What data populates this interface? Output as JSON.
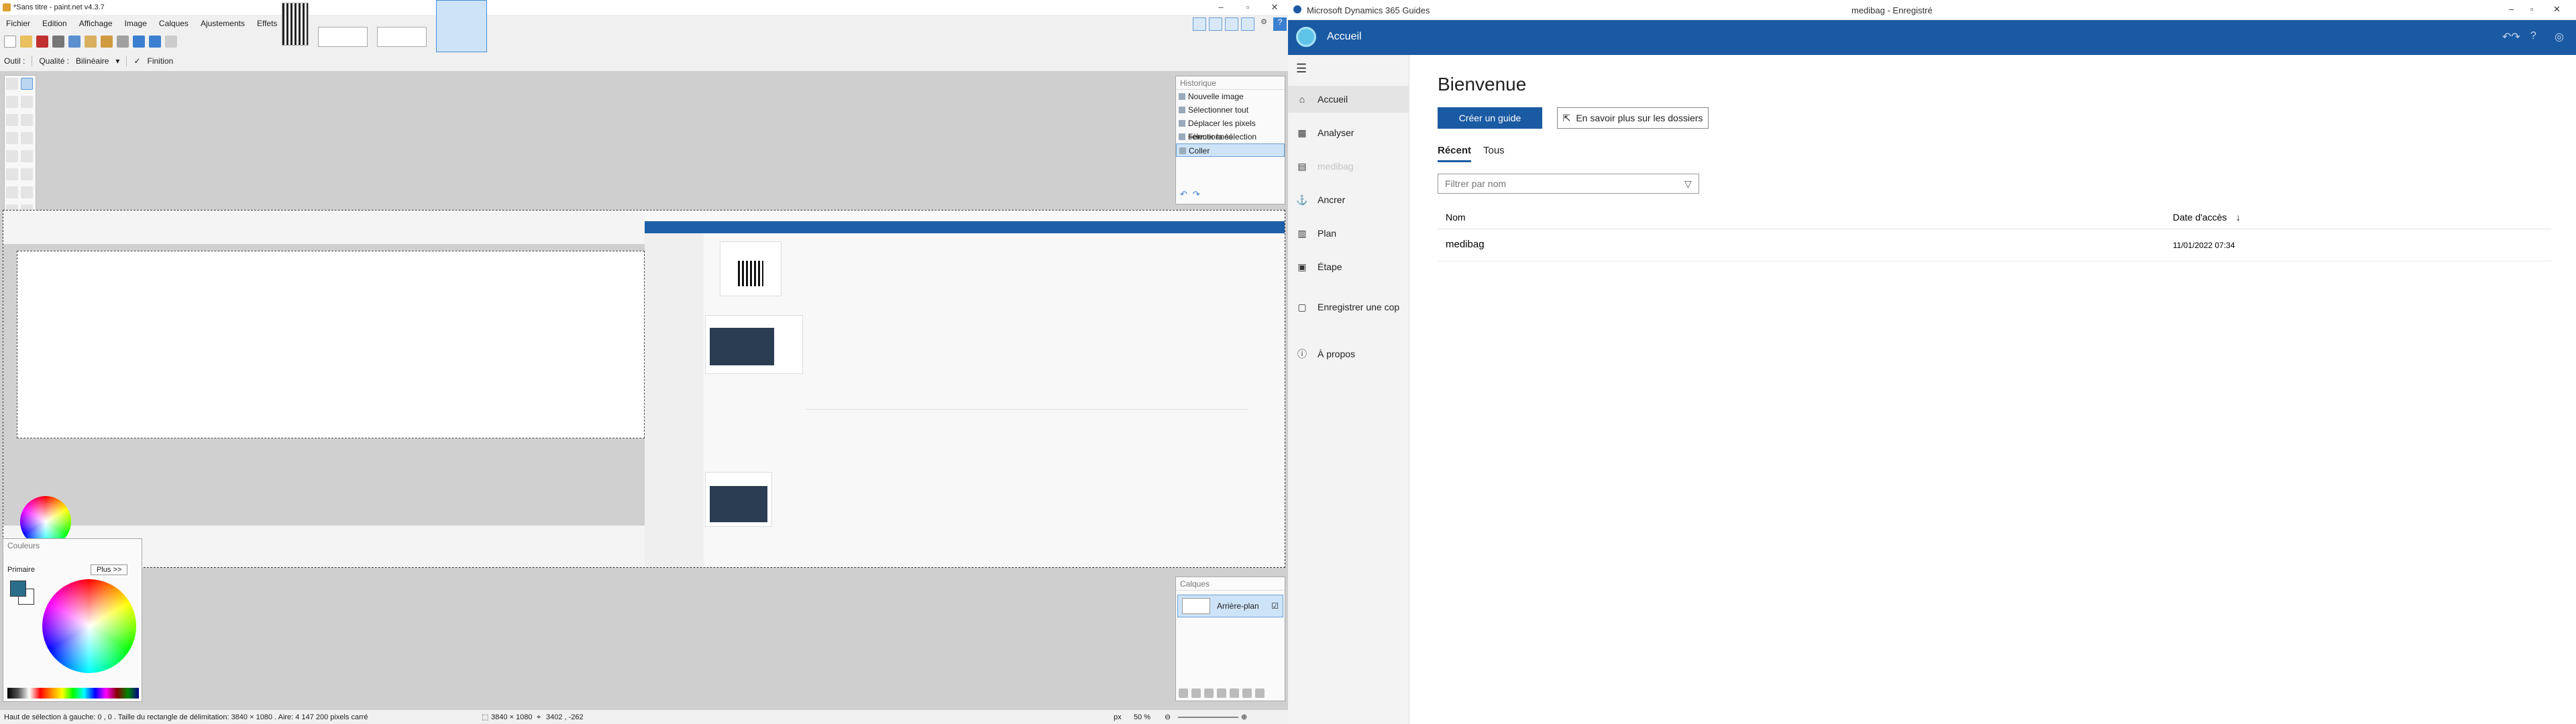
{
  "paintnet": {
    "title": "*Sans titre - paint.net v4.3.7",
    "menu": [
      "Fichier",
      "Edition",
      "Affichage",
      "Image",
      "Calques",
      "Ajustements",
      "Effets"
    ],
    "toolbar": {
      "tool_label": "Outil :",
      "quality_label": "Qualité :",
      "quality_value": "Bilinéaire",
      "finish_label": "Finition"
    },
    "history": {
      "title": "Historique",
      "items": [
        "Nouvelle image",
        "Sélectionner tout",
        "Déplacer les pixels sélectionnés",
        "Fermer la sélection",
        "Coller"
      ],
      "selected_index": 4
    },
    "layers": {
      "title": "Calques",
      "items": [
        "Arrière-plan"
      ]
    },
    "colors": {
      "title": "Couleurs",
      "primary_label": "Primaire",
      "more_button": "Plus >>",
      "primary_color": "#2a6d8a",
      "secondary_color": "#ffffff"
    },
    "status": {
      "selection_info": "Haut de sélection à gauche: 0 , 0 . Taille du rectangle de délimitation: 3840 × 1080 . Aire: 4 147 200 pixels carré",
      "image_size": "3840 × 1080",
      "cursor_pos": "3402 , -262",
      "unit": "px",
      "zoom": "50 %"
    }
  },
  "dynamics": {
    "app_title": "Microsoft Dynamics 365 Guides",
    "doc_title": "medibag - Enregistré",
    "page_title": "Accueil",
    "nav": [
      {
        "label": "Accueil",
        "icon": "home-icon",
        "glyph": "⌂",
        "active": true,
        "disabled": false
      },
      {
        "label": "Analyser",
        "icon": "chart-icon",
        "glyph": "▦",
        "active": false,
        "disabled": false
      },
      {
        "label": "medibag",
        "icon": "guide-icon",
        "glyph": "▤",
        "active": false,
        "disabled": true
      },
      {
        "label": "Ancrer",
        "icon": "anchor-icon",
        "glyph": "⚓",
        "active": false,
        "disabled": false
      },
      {
        "label": "Plan",
        "icon": "outline-icon",
        "glyph": "▥",
        "active": false,
        "disabled": false
      },
      {
        "label": "Étape",
        "icon": "step-icon",
        "glyph": "▣",
        "active": false,
        "disabled": false
      },
      {
        "label": "Enregistrer une cop",
        "icon": "save-copy-icon",
        "glyph": "▢",
        "active": false,
        "disabled": false
      }
    ],
    "about": "À propos",
    "welcome": "Bienvenue",
    "create_button": "Créer un guide",
    "learn_button": "En savoir plus sur les dossiers",
    "tabs": [
      "Récent",
      "Tous"
    ],
    "filter_placeholder": "Filtrer par nom",
    "table": {
      "col_name": "Nom",
      "col_date": "Date d'accès",
      "rows": [
        {
          "name": "medibag",
          "date": "11/01/2022 07:34"
        }
      ]
    },
    "accent": "#1a5aa3"
  }
}
